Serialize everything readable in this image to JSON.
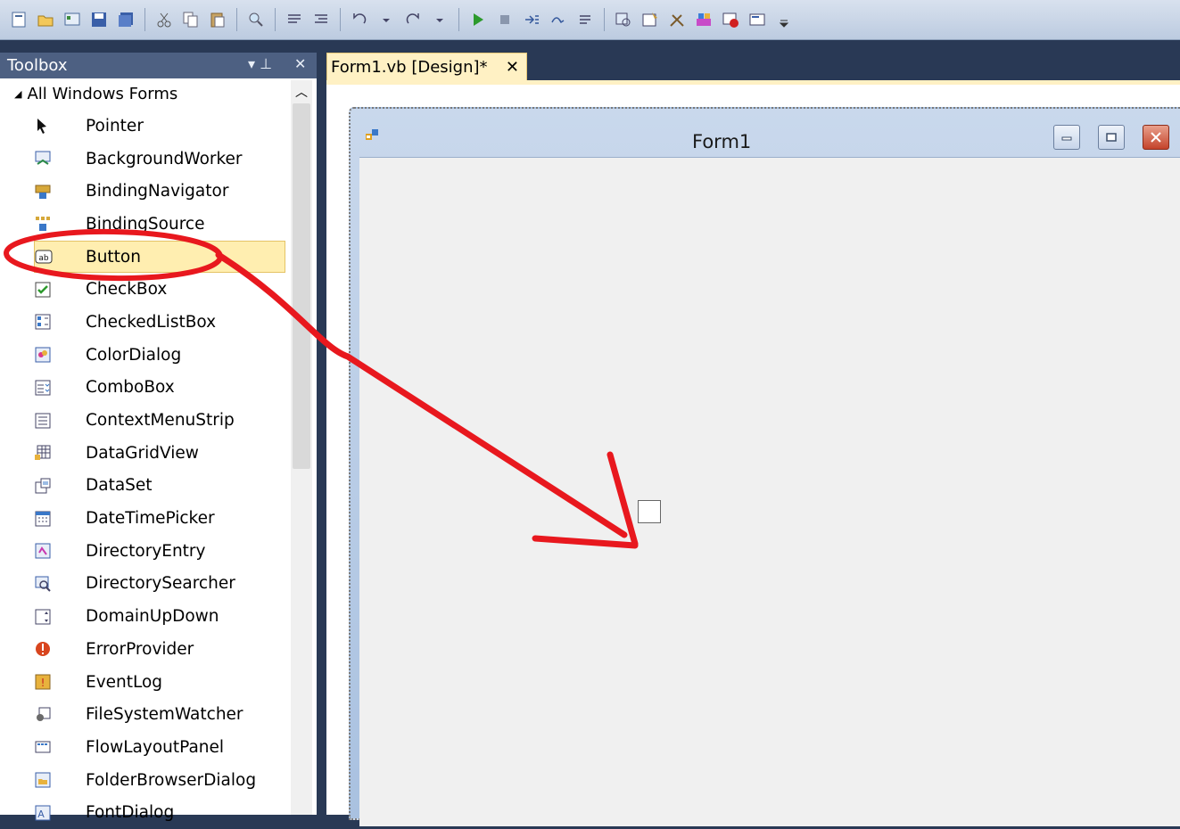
{
  "toolbox": {
    "title": "Toolbox",
    "pin_glyph": "▾ ⊥",
    "close_glyph": "✕",
    "group_label": "All Windows Forms",
    "items": [
      {
        "label": "Pointer",
        "icon": "pointer-icon"
      },
      {
        "label": "BackgroundWorker",
        "icon": "background-worker-icon"
      },
      {
        "label": "BindingNavigator",
        "icon": "binding-navigator-icon"
      },
      {
        "label": "BindingSource",
        "icon": "binding-source-icon"
      },
      {
        "label": "Button",
        "icon": "button-icon",
        "selected": true
      },
      {
        "label": "CheckBox",
        "icon": "checkbox-icon"
      },
      {
        "label": "CheckedListBox",
        "icon": "checked-listbox-icon"
      },
      {
        "label": "ColorDialog",
        "icon": "color-dialog-icon"
      },
      {
        "label": "ComboBox",
        "icon": "combobox-icon"
      },
      {
        "label": "ContextMenuStrip",
        "icon": "context-menu-icon"
      },
      {
        "label": "DataGridView",
        "icon": "datagrid-icon"
      },
      {
        "label": "DataSet",
        "icon": "dataset-icon"
      },
      {
        "label": "DateTimePicker",
        "icon": "datetime-icon"
      },
      {
        "label": "DirectoryEntry",
        "icon": "directory-entry-icon"
      },
      {
        "label": "DirectorySearcher",
        "icon": "directory-searcher-icon"
      },
      {
        "label": "DomainUpDown",
        "icon": "domain-updown-icon"
      },
      {
        "label": "ErrorProvider",
        "icon": "error-provider-icon"
      },
      {
        "label": "EventLog",
        "icon": "eventlog-icon"
      },
      {
        "label": "FileSystemWatcher",
        "icon": "filesystem-watcher-icon"
      },
      {
        "label": "FlowLayoutPanel",
        "icon": "flowlayout-icon"
      },
      {
        "label": "FolderBrowserDialog",
        "icon": "folder-browser-icon"
      },
      {
        "label": "FontDialog",
        "icon": "font-dialog-icon"
      }
    ]
  },
  "document": {
    "tab_label": "Form1.vb [Design]*",
    "tab_close": "✕"
  },
  "form": {
    "title": "Form1"
  },
  "colors": {
    "ide_background": "#293955",
    "toolbox_header": "#4d6082",
    "selection": "#ffeeb0",
    "tab_active": "#fff1c4",
    "annotation": "#e8181e"
  }
}
